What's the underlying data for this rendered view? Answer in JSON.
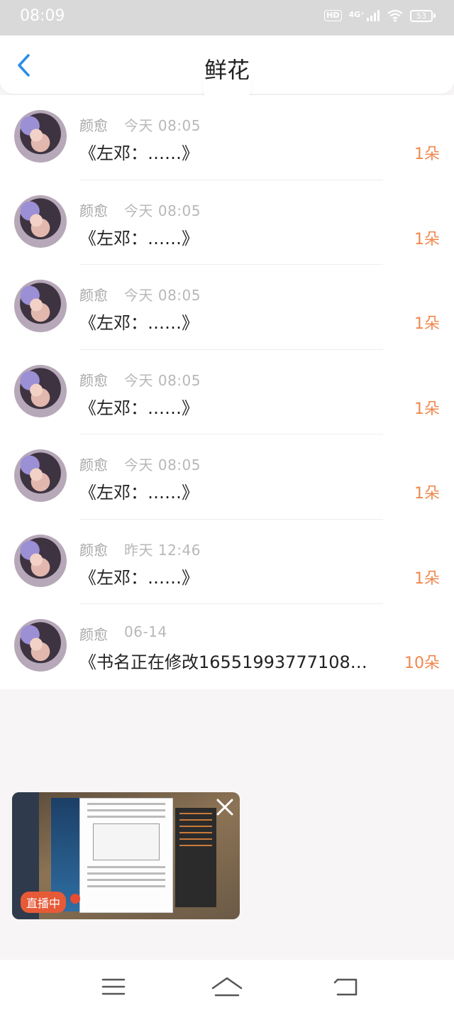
{
  "status_bar": {
    "time": "08:09",
    "hd": "HD",
    "network": "4G⁺",
    "battery": "53"
  },
  "header": {
    "title": "鲜花"
  },
  "items": [
    {
      "author": "颜愈",
      "time": "今天 08:05",
      "book": "《左邓：……》",
      "count": "1朵"
    },
    {
      "author": "颜愈",
      "time": "今天 08:05",
      "book": "《左邓：……》",
      "count": "1朵"
    },
    {
      "author": "颜愈",
      "time": "今天 08:05",
      "book": "《左邓：……》",
      "count": "1朵"
    },
    {
      "author": "颜愈",
      "time": "今天 08:05",
      "book": "《左邓：……》",
      "count": "1朵"
    },
    {
      "author": "颜愈",
      "time": "今天 08:05",
      "book": "《左邓：……》",
      "count": "1朵"
    },
    {
      "author": "颜愈",
      "time": "昨天 12:46",
      "book": "《左邓：……》",
      "count": "1朵"
    },
    {
      "author": "颜愈",
      "time": "06-14",
      "book": "《书名正在修改16551993777108…",
      "count": "10朵"
    }
  ],
  "pip": {
    "live_label": "直播中"
  },
  "colors": {
    "accent_blue": "#2b8de6",
    "count_orange": "#f0884e",
    "live_red": "#e65a37"
  }
}
